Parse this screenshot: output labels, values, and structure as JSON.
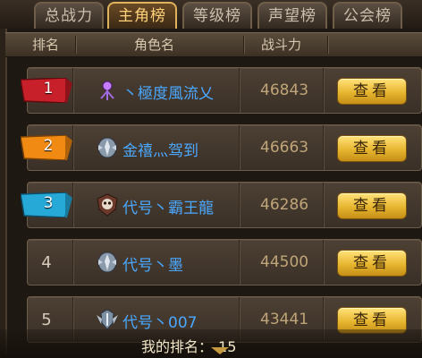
{
  "tabs": [
    {
      "label": "总战力",
      "active": false
    },
    {
      "label": "主角榜",
      "active": true
    },
    {
      "label": "等级榜",
      "active": false
    },
    {
      "label": "声望榜",
      "active": false
    },
    {
      "label": "公会榜",
      "active": false
    }
  ],
  "header": {
    "rank": "排名",
    "name": "角色名",
    "power": "战斗力"
  },
  "rows": [
    {
      "rank": "1",
      "name": "丶極度風流乂",
      "power": "46843",
      "button": "查看",
      "flag_color": "#c8202a",
      "emblem": "mage-staff-icon"
    },
    {
      "rank": "2",
      "name": "金禧灬驾到",
      "power": "46663",
      "button": "查看",
      "flag_color": "#f08a12",
      "emblem": "winged-helmet-icon"
    },
    {
      "rank": "3",
      "name": "代号丶霸王龍",
      "power": "46286",
      "button": "查看",
      "flag_color": "#27a9d8",
      "emblem": "skull-shield-icon"
    },
    {
      "rank": "4",
      "name": "代号丶墨",
      "power": "44500",
      "button": "查看",
      "flag_color": "",
      "emblem": "winged-helmet-icon"
    },
    {
      "rank": "5",
      "name": "代号丶007",
      "power": "43441",
      "button": "查看",
      "flag_color": "",
      "emblem": "winged-crest-icon"
    }
  ],
  "footer": {
    "label": "我的排名：",
    "rank": "15"
  }
}
